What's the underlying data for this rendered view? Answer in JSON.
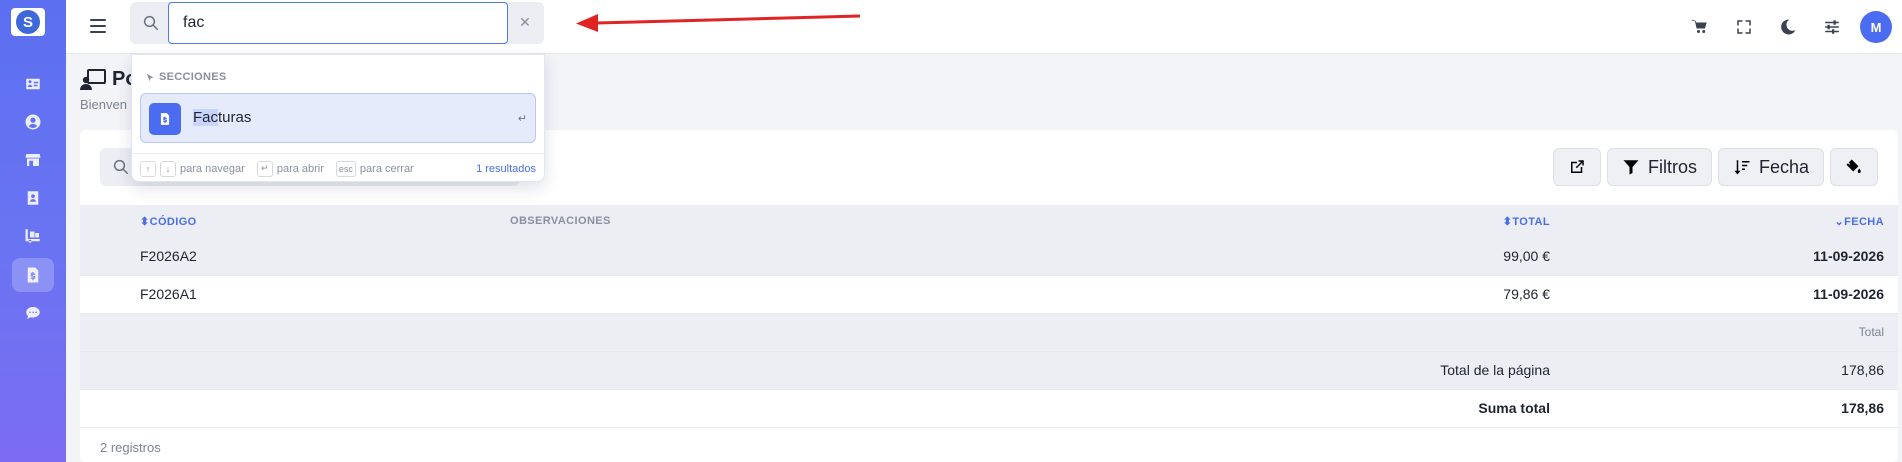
{
  "search": {
    "value": "fac",
    "clear_symbol": "✕"
  },
  "logo": {
    "glyph": "S"
  },
  "avatar": {
    "initial": "M"
  },
  "page": {
    "title": "Po",
    "subtitle": "Bienven"
  },
  "dropdown": {
    "section_label": "SECCIONES",
    "item": {
      "highlight": "Fac",
      "rest": "turas",
      "enter_symbol": "↵"
    },
    "footer": {
      "up_key": "↑",
      "down_key": "↓",
      "navigate_label": "para navegar",
      "enter_key": "↵",
      "open_label": "para abrir",
      "esc_key": "esc",
      "close_label": "para cerrar",
      "count": "1 resultados"
    }
  },
  "toolbar": {
    "filters_label": "Filtros",
    "date_label": "Fecha"
  },
  "table": {
    "headers": {
      "code": "CÓDIGO",
      "notes": "OBSERVACIONES",
      "total": "TOTAL",
      "date": "FECHA"
    },
    "rows": [
      {
        "code": "F2026A2",
        "notes": "",
        "total": "99,00 €",
        "date": "11-09-2026"
      },
      {
        "code": "F2026A1",
        "notes": "",
        "total": "79,86 €",
        "date": "11-09-2026"
      }
    ],
    "footer": {
      "total_label": "Total",
      "page_total_label": "Total de la página",
      "page_total_value": "178,86",
      "sum_total_label": "Suma total",
      "sum_total_value": "178,86"
    },
    "records": "2 registros"
  },
  "colors": {
    "accent": "#4b6cf0",
    "sidebar_top": "#5b6ff0",
    "sidebar_bottom": "#7c6cf3",
    "arrow": "#e02424"
  }
}
